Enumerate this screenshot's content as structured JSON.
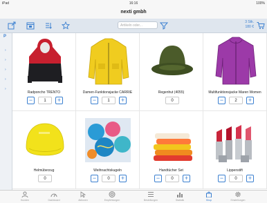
{
  "status": {
    "carrier": "iPad",
    "time": "16:16",
    "battery": "100%"
  },
  "title": "nexti gmbh",
  "search": {
    "placeholder": "Artikeln oder..."
  },
  "cart": {
    "count": "3 Stk.",
    "total": "180 €"
  },
  "sidebar": {
    "letter": "P"
  },
  "products": [
    {
      "name": "Radponcho TRENTO",
      "qty": "1",
      "stepper": true
    },
    {
      "name": "Damen-Funktionsjacke CARRIE",
      "qty": "1",
      "stepper": true
    },
    {
      "name": "Regenhut (4055)",
      "qty": "0",
      "stepper": false
    },
    {
      "name": "Multifunktionsjacke Maren Women",
      "qty": "2",
      "stepper": true
    },
    {
      "name": "Helmüberzug",
      "qty": "0",
      "stepper": false
    },
    {
      "name": "Weihnachtskugeln",
      "qty": "0",
      "stepper": true
    },
    {
      "name": "Handtücher Set",
      "qty": "0",
      "stepper": true
    },
    {
      "name": "Lippenstift",
      "qty": "0",
      "stepper": true
    }
  ],
  "tabs": [
    {
      "label": "Kunden",
      "icon": "people-icon",
      "active": false
    },
    {
      "label": "Dashboard",
      "icon": "speedometer-icon",
      "active": false
    },
    {
      "label": "Aktionen",
      "icon": "cursor-icon",
      "active": false
    },
    {
      "label": "Empfehlungen",
      "icon": "target-icon",
      "active": false
    },
    {
      "label": "Bestellungen",
      "icon": "list-icon",
      "active": false
    },
    {
      "label": "Statistik",
      "icon": "chart-icon",
      "active": false
    },
    {
      "label": "Shop",
      "icon": "bag-icon",
      "active": true
    },
    {
      "label": "Einstellungen",
      "icon": "gear-icon",
      "active": false
    }
  ],
  "colors": {
    "accent": "#3a7fd0",
    "toolbar": "#dfe6ee"
  }
}
